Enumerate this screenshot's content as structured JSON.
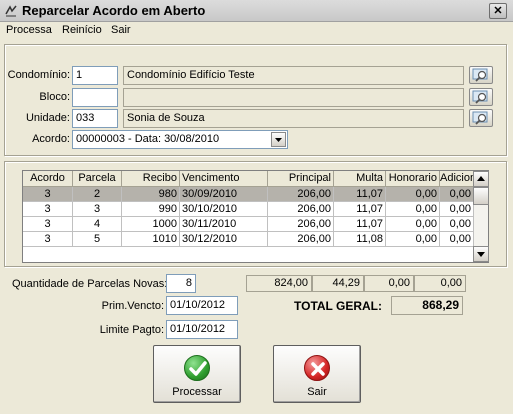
{
  "window": {
    "title": "Reparcelar Acordo em Aberto",
    "close_label": "✕"
  },
  "menu": [
    {
      "label": "Processa"
    },
    {
      "label": "Reinício"
    },
    {
      "label": "Sair"
    }
  ],
  "form": {
    "condominio_label": "Condomínio:",
    "condominio_code": "1",
    "condominio_name": "Condomínio Edifício Teste",
    "bloco_label": "Bloco:",
    "bloco_code": "",
    "bloco_name": "",
    "unidade_label": "Unidade:",
    "unidade_code": "033",
    "unidade_name": "Sonia de Souza",
    "acordo_label": "Acordo:",
    "acordo_value": "00000003  -  Data:  30/08/2010"
  },
  "grid": {
    "columns": [
      "Acordo",
      "Parcela",
      "Recibo",
      "Vencimento",
      "Principal",
      "Multa",
      "Honorario",
      "Adicional"
    ],
    "rows": [
      [
        "3",
        "2",
        "980",
        "30/09/2010",
        "206,00",
        "11,07",
        "0,00",
        "0,00"
      ],
      [
        "3",
        "3",
        "990",
        "30/10/2010",
        "206,00",
        "11,07",
        "0,00",
        "0,00"
      ],
      [
        "3",
        "4",
        "1000",
        "30/11/2010",
        "206,00",
        "11,07",
        "0,00",
        "0,00"
      ],
      [
        "3",
        "5",
        "1010",
        "30/12/2010",
        "206,00",
        "11,08",
        "0,00",
        "0,00"
      ]
    ]
  },
  "summary": {
    "qtd_label": "Quantidade de Parcelas Novas:",
    "qtd_value": "8",
    "total_principal": "824,00",
    "total_multa": "44,29",
    "total_honorario": "0,00",
    "total_adicional": "0,00",
    "prim_label": "Prim.Vencto:",
    "prim_value": "01/10/2012",
    "limite_label": "Limite Pagto:",
    "limite_value": "01/10/2012",
    "total_geral_label": "TOTAL GERAL:",
    "total_geral_value": "868,29"
  },
  "buttons": {
    "processar": "Processar",
    "sair": "Sair"
  },
  "colors": {
    "check_green": "#2f9e2f",
    "exit_red": "#d42424"
  }
}
